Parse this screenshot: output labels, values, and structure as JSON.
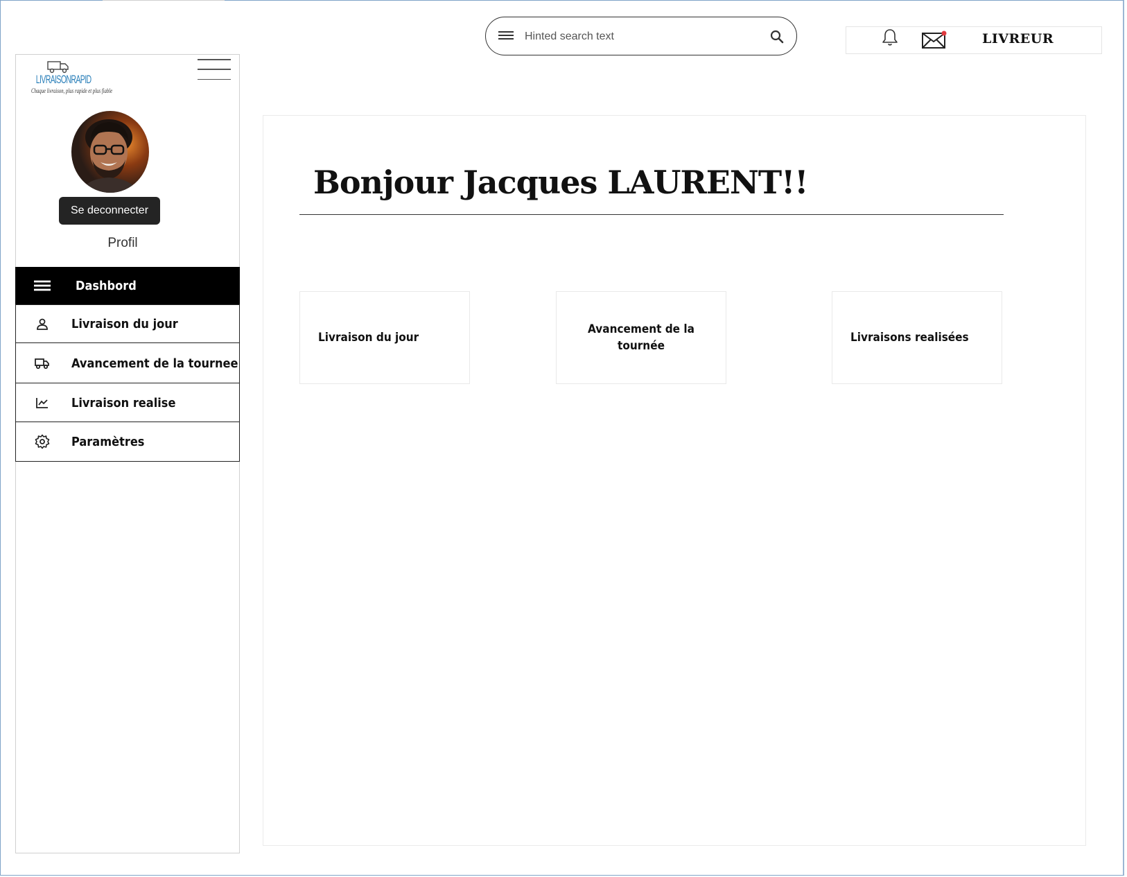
{
  "search": {
    "placeholder": "Hinted search text"
  },
  "header": {
    "role_label": "LIVREUR",
    "notification_dot_color": "#e0393e"
  },
  "brand": {
    "name": "LIVRAISONRAPID",
    "tagline": "Chaque livraison, plus rapide et plus fiable",
    "color": "#2a7fb9"
  },
  "sidebar": {
    "logout_label": "Se deconnecter",
    "profile_label": "Profil",
    "items": [
      {
        "label": "Dashbord",
        "icon": "menu-icon",
        "active": true
      },
      {
        "label": "Livraison du jour",
        "icon": "person-icon",
        "active": false
      },
      {
        "label": "Avancement de la tournee",
        "icon": "truck-icon",
        "active": false
      },
      {
        "label": "Livraison realise",
        "icon": "chart-icon",
        "active": false
      },
      {
        "label": "Paramètres",
        "icon": "gear-icon",
        "active": false
      }
    ]
  },
  "main": {
    "greeting": "Bonjour Jacques LAURENT!!",
    "cards": [
      {
        "label": "Livraison du jour"
      },
      {
        "label": "Avancement de la tournée"
      },
      {
        "label": "Livraisons realisées"
      }
    ]
  }
}
